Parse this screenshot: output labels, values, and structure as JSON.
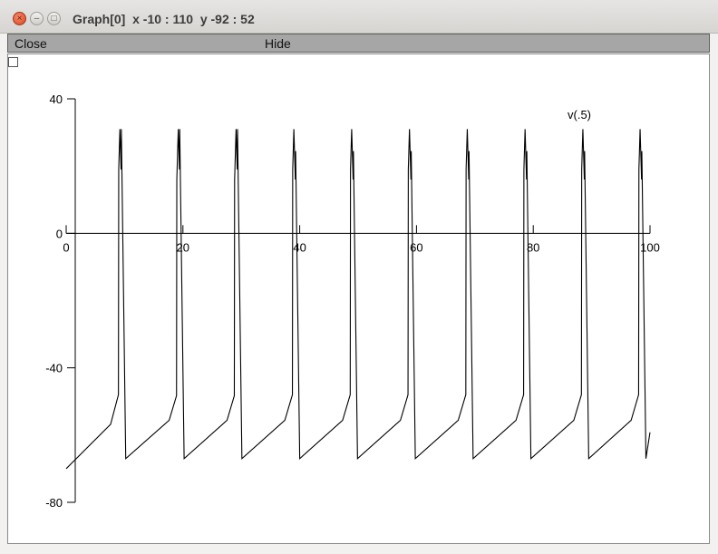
{
  "window": {
    "title": "Graph[0]  x -10 : 110  y -92 : 52",
    "close_glyph": "×",
    "min_glyph": "–",
    "max_glyph": "□"
  },
  "menu": {
    "close_label": "Close",
    "hide_label": "Hide"
  },
  "chart_data": {
    "type": "line",
    "title": "",
    "xlabel": "",
    "ylabel": "",
    "series": [
      {
        "name": "v(.5)"
      }
    ],
    "xlim": [
      0,
      100
    ],
    "ylim": [
      -80,
      40
    ],
    "x_ticks": [
      "0",
      "20",
      "40",
      "60",
      "80",
      "100"
    ],
    "y_ticks": [
      "40",
      "0",
      "-40",
      "-80"
    ],
    "x_tick_values": [
      0,
      20,
      40,
      60,
      80,
      100
    ],
    "y_tick_values": [
      40,
      0,
      -40,
      -80
    ],
    "spike_times": [
      9.2,
      19.2,
      29.1,
      39.0,
      48.9,
      58.8,
      68.7,
      78.6,
      88.5,
      98.3
    ],
    "spike_peak_mv": 31,
    "trough_mv": -67,
    "start_mv": -70,
    "end_mv": -66,
    "grid": false
  }
}
